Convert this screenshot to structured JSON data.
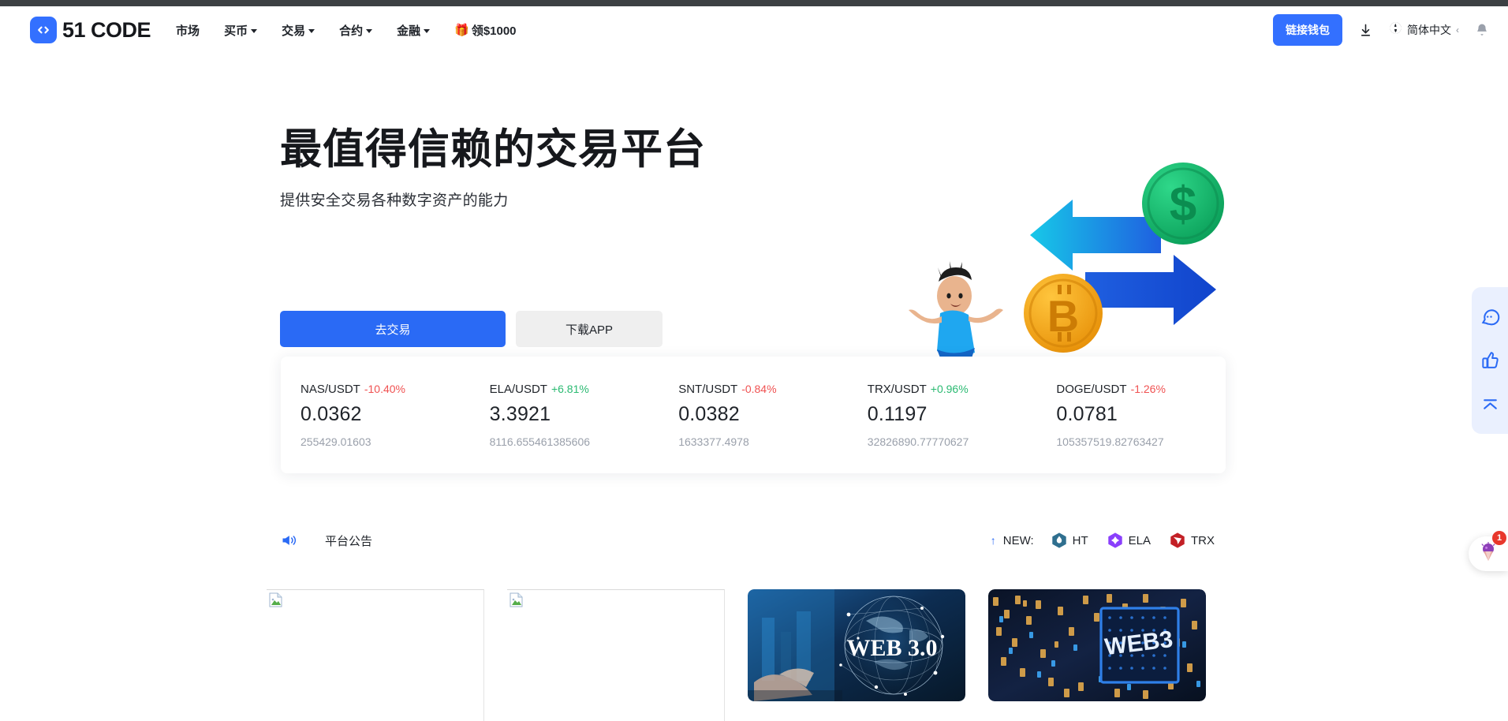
{
  "header": {
    "brand": {
      "mark_glyph": "</>",
      "name": "51 CODE"
    },
    "nav": [
      {
        "label": "市场",
        "has_caret": false
      },
      {
        "label": "买币",
        "has_caret": true
      },
      {
        "label": "交易",
        "has_caret": true
      },
      {
        "label": "合约",
        "has_caret": true
      },
      {
        "label": "金融",
        "has_caret": true
      }
    ],
    "promo": {
      "icon": "gift-icon",
      "glyph": "🎁",
      "label": "领$1000"
    },
    "wallet_button": "链接钱包",
    "download_icon": "download-icon",
    "language": {
      "icon": "globe-icon",
      "label": "简体中文",
      "caret": "‹"
    },
    "notification_icon": "bell-icon"
  },
  "hero": {
    "title": "最值得信赖的交易平台",
    "subtitle": "提供安全交易各种数字资产的能力",
    "primary_button": "去交易",
    "secondary_button": "下载APP",
    "illustration": "crypto-exchange-arrows-illustration"
  },
  "tickers": [
    {
      "pair": "NAS/USDT",
      "change": "-10.40%",
      "direction": "down",
      "price": "0.0362",
      "volume": "255429.01603"
    },
    {
      "pair": "ELA/USDT",
      "change": "+6.81%",
      "direction": "up",
      "price": "3.3921",
      "volume": "8116.655461385606"
    },
    {
      "pair": "SNT/USDT",
      "change": "-0.84%",
      "direction": "down",
      "price": "0.0382",
      "volume": "1633377.4978"
    },
    {
      "pair": "TRX/USDT",
      "change": "+0.96%",
      "direction": "up",
      "price": "0.1197",
      "volume": "32826890.77770627"
    },
    {
      "pair": "DOGE/USDT",
      "change": "-1.26%",
      "direction": "down",
      "price": "0.0781",
      "volume": "105357519.82763427"
    }
  ],
  "notice": {
    "icon": "megaphone-icon",
    "label": "平台公告",
    "new_arrow": "↑",
    "new_label": "NEW:",
    "tokens": [
      {
        "name": "HT",
        "icon": "ht-token-icon",
        "color": "#2f6f8f"
      },
      {
        "name": "ELA",
        "icon": "ela-token-icon",
        "color": "#8a3ffc"
      },
      {
        "name": "TRX",
        "icon": "trx-token-icon",
        "color": "#c32026"
      }
    ]
  },
  "promo_cards": [
    {
      "type": "broken-image",
      "alt": "",
      "caption": ""
    },
    {
      "type": "broken-image",
      "alt": "",
      "caption": ""
    },
    {
      "type": "image",
      "alt": "WEB 3.0",
      "caption": "WEB 3.0"
    },
    {
      "type": "image",
      "alt": "WEB3",
      "caption": "WEB3"
    }
  ],
  "side_rail": [
    {
      "icon": "chat-bubble-icon",
      "name": "customer-service"
    },
    {
      "icon": "thumbs-up-icon",
      "name": "feedback"
    },
    {
      "icon": "scroll-to-top-icon",
      "name": "back-to-top"
    }
  ],
  "notify_widget": {
    "icon": "gift-balloon-icon",
    "badge": "1"
  },
  "colors": {
    "brand_blue": "#3370ff",
    "primary_blue": "#2a6af5",
    "up_green": "#2bba72",
    "down_red": "#f05252",
    "badge_red": "#e8372c",
    "rail_bg": "#eaf0fe",
    "text_dark": "#1f2329",
    "text_muted": "#9aa0ab"
  }
}
